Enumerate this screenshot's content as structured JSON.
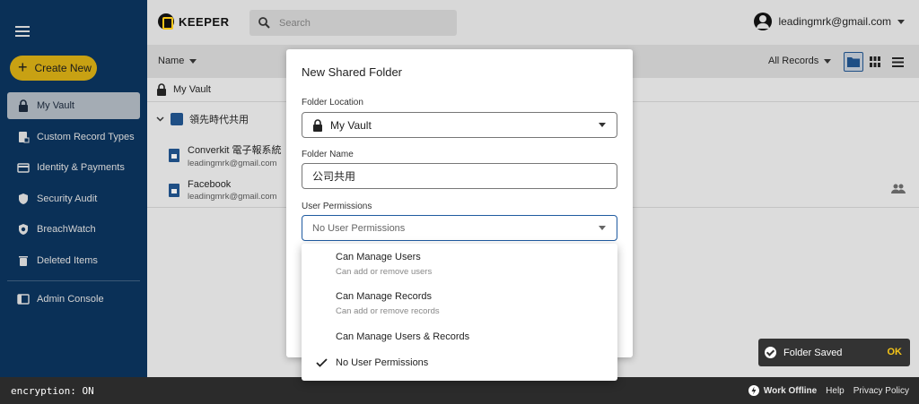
{
  "app": {
    "logo_text": "KEEPER",
    "brand_color": "#f5c518",
    "nav_color": "#0d3b6b"
  },
  "header": {
    "search_placeholder": "Search",
    "account_email": "leadingmrk@gmail.com"
  },
  "sidebar": {
    "create_label": "Create New",
    "items": [
      {
        "label": "My Vault",
        "icon": "lock-icon",
        "active": true
      },
      {
        "label": "Custom Record Types",
        "icon": "record-type-icon"
      },
      {
        "label": "Identity & Payments",
        "icon": "card-icon"
      },
      {
        "label": "Security Audit",
        "icon": "shield-icon"
      },
      {
        "label": "BreachWatch",
        "icon": "breachwatch-icon"
      },
      {
        "label": "Deleted Items",
        "icon": "trash-icon"
      },
      {
        "label": "Admin Console",
        "icon": "console-icon"
      }
    ]
  },
  "toolbar": {
    "sort_label": "Name",
    "filter_label": "All Records"
  },
  "vault": {
    "root_label": "My Vault",
    "shared_folder": "領先時代共用",
    "records": [
      {
        "title": "Converkit 電子報系統",
        "sub": "leadingmrk@gmail.com"
      },
      {
        "title": "Facebook",
        "sub": "leadingmrk@gmail.com"
      }
    ]
  },
  "modal": {
    "title": "New Shared Folder",
    "location_label": "Folder Location",
    "location_value": "My Vault",
    "name_label": "Folder Name",
    "name_value": "公司共用",
    "perm_label": "User Permissions",
    "perm_value": "No User Permissions"
  },
  "menu": {
    "options": [
      {
        "title": "Can Manage Users",
        "desc": "Can add or remove users"
      },
      {
        "title": "Can Manage Records",
        "desc": "Can add or remove records"
      },
      {
        "title": "Can Manage Users & Records",
        "desc": ""
      },
      {
        "title": "No User Permissions",
        "desc": "",
        "selected": true
      }
    ]
  },
  "toast": {
    "message": "Folder Saved",
    "action": "OK"
  },
  "footer": {
    "encryption": "encryption: ON",
    "offline": "Work Offline",
    "help": "Help",
    "privacy": "Privacy Policy"
  }
}
